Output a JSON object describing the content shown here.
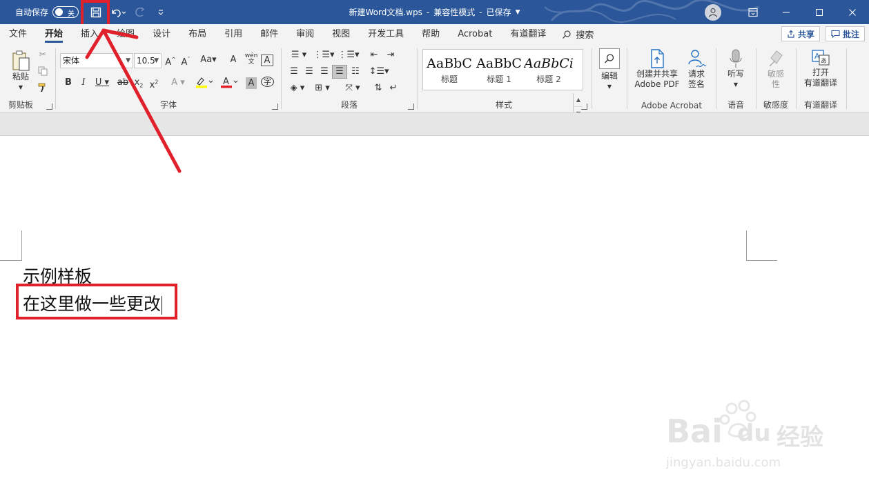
{
  "titlebar": {
    "autosave_label": "自动保存",
    "autosave_state": "关",
    "doc_name": "新建Word文档.wps",
    "separator": "-",
    "mode": "兼容性模式",
    "separator2": "-",
    "save_state": "已保存",
    "bg_color": "#2b579a"
  },
  "tabs": [
    "文件",
    "开始",
    "插入",
    "绘图",
    "设计",
    "布局",
    "引用",
    "邮件",
    "审阅",
    "视图",
    "开发工具",
    "帮助",
    "Acrobat",
    "有道翻译"
  ],
  "active_tab": "开始",
  "search_label": "搜索",
  "share_label": "共享",
  "comments_label": "批注",
  "ribbon": {
    "clipboard": {
      "paste": "粘贴",
      "label": "剪贴板"
    },
    "font": {
      "name": "宋体",
      "size": "10.5",
      "label": "字体"
    },
    "paragraph": {
      "label": "段落"
    },
    "styles": {
      "label": "样式",
      "items": [
        {
          "preview": "AaBbC",
          "name": "标题"
        },
        {
          "preview": "AaBbC",
          "name": "标题 1"
        },
        {
          "preview": "AaBbCi",
          "name": "标题 2"
        }
      ]
    },
    "editing": {
      "label": "编辑"
    },
    "acrobat": {
      "create": "创建并共享",
      "create2": "Adobe PDF",
      "request": "请求",
      "request2": "签名",
      "label": "Adobe Acrobat"
    },
    "voice": {
      "dictate": "听写",
      "label": "语音"
    },
    "sensitivity": {
      "btn": "敏感",
      "btn2": "性",
      "label": "敏感度"
    },
    "youdao": {
      "open": "打开",
      "open2": "有道翻译",
      "label": "有道翻译"
    }
  },
  "document": {
    "line1": "示例样板",
    "line2": "在这里做一些更改"
  },
  "annotations": {
    "color": "#e0202a"
  },
  "watermark": {
    "brand": "Bai",
    "brand2": "du",
    "cn": "经验",
    "url": "jingyan.baidu.com"
  }
}
